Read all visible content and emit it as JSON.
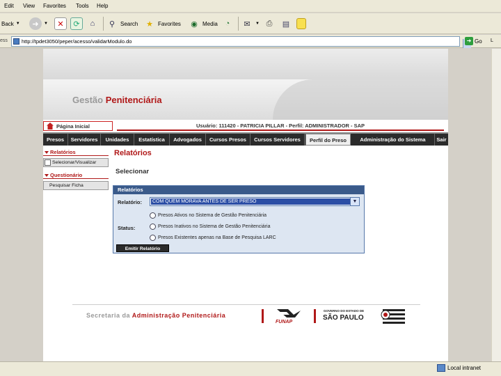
{
  "menu": [
    "Edit",
    "View",
    "Favorites",
    "Tools",
    "Help"
  ],
  "toolbar": {
    "back_label": "Back",
    "search_label": "Search",
    "favorites_label": "Favorites",
    "media_label": "Media"
  },
  "address": {
    "label": "ess",
    "url": "http://tpdet3050/peper/acesso/validarModulo.do",
    "go_label": "Go",
    "links_label": "L"
  },
  "site": {
    "brand_gray": "Gestão",
    "brand_red": "Penitenciária",
    "home_link": "Página Inicial",
    "user_info": "Usuário: 111420 - PATRICIA PILLAR - Perfil: ADMINISTRADOR - SAP",
    "nav": [
      "Presos",
      "Servidores",
      "Unidades",
      "Estatística",
      "Advogados",
      "Cursos Presos",
      "Cursos Servidores",
      "Perfil do Preso",
      "Administração do Sistema",
      "Sair"
    ],
    "active_nav": "Perfil do Preso"
  },
  "sidebar": {
    "section1": "Relatórios",
    "section1_item": "Selecionar/Visualizar",
    "section2": "Questionário",
    "section2_item": "Pesquisar Ficha"
  },
  "content": {
    "title": "Relatórios",
    "subtitle": "Selecionar",
    "panel_title": "Relatórios",
    "report_label": "Relatório:",
    "report_selected": "COM QUEM MORAVA ANTES DE SER PRESO",
    "status_label": "Status:",
    "status_options": [
      "Presos Ativos no Sistema de Gestão Penitenciária",
      "Presos Inativos no Sistema de Gestão Penitenciária",
      "Presos Existentes apenas na Base de Pesquisa LARC"
    ],
    "emit_button": "Emitir Relatório"
  },
  "footer": {
    "text_gray": "Secretaria da",
    "text_red": "Administração Penitenciária",
    "funap": "FUNAP",
    "gov_small": "GOVERNO DO ESTADO DE",
    "gov_big": "SÃO PAULO"
  },
  "status": {
    "zone": "Local intranet"
  },
  "colors": {
    "brand_red": "#b01818",
    "nav_bg": "#2b2b2b",
    "panel_head": "#3a5a8a",
    "select_highlight": "#2b4ea5"
  }
}
